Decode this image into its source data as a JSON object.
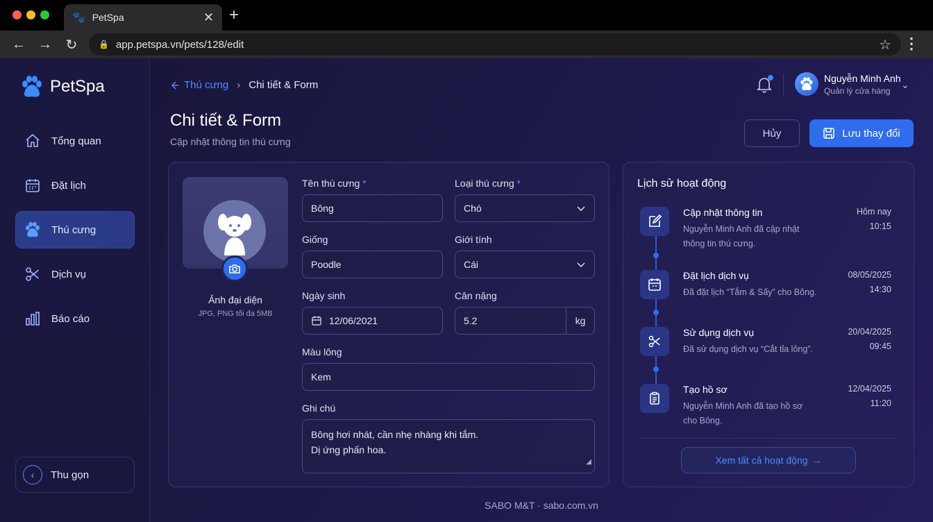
{
  "browser": {
    "tab_title": "PetSpa",
    "tab_close": "✕",
    "new_tab": "+",
    "url": "app.petspa.vn/pets/128/edit"
  },
  "brand": {
    "name": "PetSpa",
    "accent": "#2f6dee"
  },
  "sidebar": {
    "items": [
      {
        "label": "Tổng quan",
        "icon": "home-icon"
      },
      {
        "label": "Đặt lịch",
        "icon": "calendar-icon"
      },
      {
        "label": "Thú cưng",
        "icon": "paw-icon",
        "active": true
      },
      {
        "label": "Dịch vụ",
        "icon": "scissors-icon"
      },
      {
        "label": "Báo cáo",
        "icon": "bar-chart-icon"
      }
    ],
    "collapse_label": "Thu gọn"
  },
  "header": {
    "breadcrumb_parent": "Thú cưng",
    "breadcrumb_current": "Chi tiết & Form",
    "breadcrumb_sep": "›",
    "title": "Chi tiết & Form",
    "subtitle": "Cập nhật thông tin thú cưng",
    "user_name": "Nguyễn Minh Anh",
    "user_role": "Quản lý cửa hàng",
    "cancel_label": "Hủy",
    "save_label": "Lưu thay đổi"
  },
  "form": {
    "photo_label": "Ảnh đại diện",
    "photo_hint": "JPG, PNG tối đa 5MB",
    "name_label": "Tên thú cưng",
    "name_value": "Bông",
    "type_label": "Loại thú cưng",
    "type_value": "Chó",
    "breed_label": "Giống",
    "breed_value": "Poodle",
    "gender_label": "Giới tính",
    "gender_value": "Cái",
    "dob_label": "Ngày sinh",
    "dob_value": "12/06/2021",
    "weight_label": "Cân nặng",
    "weight_value": "5.2",
    "weight_unit": "kg",
    "color_label": "Màu lông",
    "color_value": "Kem",
    "notes_label": "Ghi chú",
    "notes_line1": "Bông hơi nhát, cần nhẹ nhàng khi tắm.",
    "notes_line2": "Dị ứng phấn hoa.",
    "required_mark": "*"
  },
  "history": {
    "title": "Lịch sử hoạt động",
    "items": [
      {
        "title": "Cập nhật thông tin",
        "desc": "Nguyễn Minh Anh đã cập nhật thông tin thú cưng.",
        "date": "Hôm nay",
        "time": "10:15",
        "icon": "edit-icon"
      },
      {
        "title": "Đặt lịch dịch vụ",
        "desc": "Đã đặt lịch “Tắm & Sấy” cho Bông.",
        "date": "08/05/2025",
        "time": "14:30",
        "icon": "calendar-icon"
      },
      {
        "title": "Sử dụng dịch vụ",
        "desc": "Đã sử dụng dịch vụ “Cắt tỉa lông”.",
        "date": "20/04/2025",
        "time": "09:45",
        "icon": "scissors-icon"
      },
      {
        "title": "Tạo hồ sơ",
        "desc": "Nguyễn Minh Anh đã tạo hồ sơ cho Bông.",
        "date": "12/04/2025",
        "time": "11:20",
        "icon": "clipboard-icon"
      }
    ],
    "view_all_label": "Xem tất cả hoạt động"
  },
  "footer": {
    "text": "SABO M&T · sabo.com.vn"
  }
}
